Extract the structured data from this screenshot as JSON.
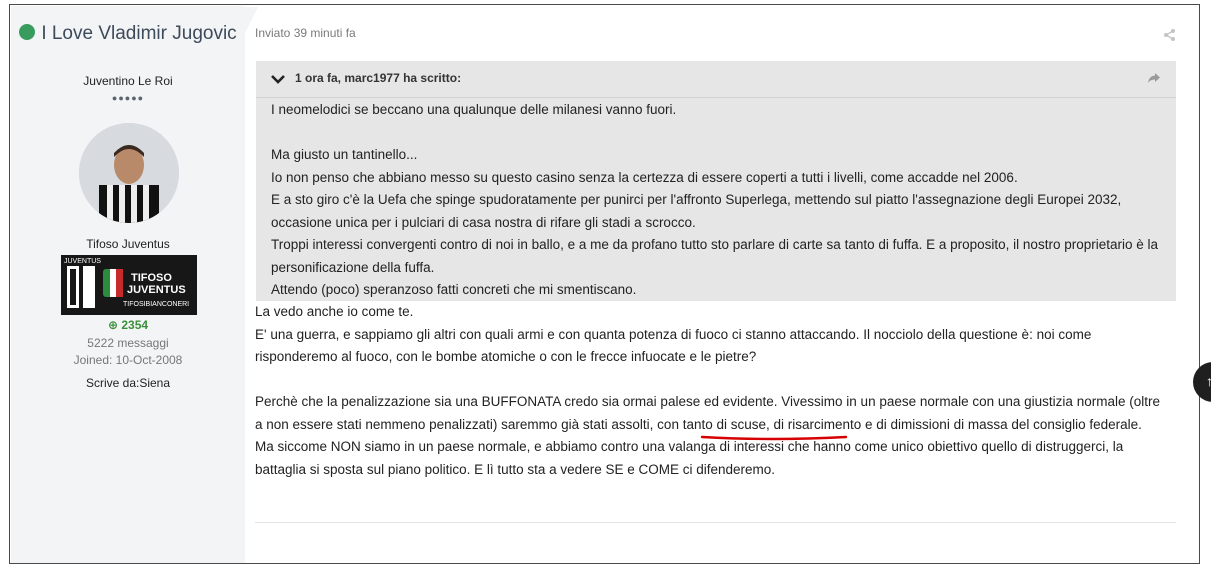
{
  "author": {
    "name": "I Love Vladimir Jugovic",
    "title": "Juventino Le Roi",
    "rank": "Tifoso Juventus",
    "reputation": "2354",
    "posts": "5222 messaggi",
    "joined": "Joined: 10-Oct-2008",
    "location": "Scrive da:Siena",
    "online_color": "#3a9b5f",
    "badge": {
      "top_label": "JUVENTUS",
      "line1": "TIFOSO",
      "line2": "JUVENTUS",
      "site": "TIFOSIBIANCONERI"
    }
  },
  "post": {
    "meta": "Inviato 39 minuti fa",
    "quote": {
      "citation": "1 ora fa, marc1977 ha scritto:",
      "lines": [
        "I neomelodici se beccano una qualunque delle milanesi vanno fuori.",
        "",
        "Ma giusto un tantinello...",
        "Io non penso che abbiano messo su questo casino senza la certezza di essere coperti a tutti i livelli, come accadde nel 2006.",
        "E a sto giro c'è la Uefa che spinge spudoratamente per punirci per l'affronto Superlega, mettendo sul piatto l'assegnazione degli Europei 2032, occasione unica per i pulciari di casa nostra di rifare gli stadi a scrocco.",
        "Troppi interessi convergenti contro di noi in ballo, e a me da profano tutto sto parlare di carte sa tanto di fuffa. E a proposito, il nostro proprietario è la personificazione della fuffa.",
        "Attendo (poco) speranzoso fatti concreti che mi smentiscano."
      ]
    },
    "body": {
      "p1": "La vedo anche io come te.",
      "p2": "E' una guerra, e sappiamo gli altri con quali armi e con quanta potenza di fuoco ci stanno attaccando. Il nocciolo della questione è: noi come risponderemo al fuoco, con le bombe atomiche o con le frecce infuocate e le pietre?",
      "p3": "Perchè che la penalizzazione sia una BUFFONATA credo sia ormai palese ed evidente. Vivessimo in un paese normale con una giustizia normale (oltre a non essere stati nemmeno penalizzati) saremmo già stati assolti, con tanto di scuse, di risarcimento e di dimissioni di massa del consiglio federale.",
      "p4": "Ma siccome NON siamo in un paese normale, e abbiamo contro una valanga di interessi che hanno come unico obiettivo quello di distruggerci, la battaglia si sposta sul piano politico. E lì tutto sta a vedere SE e COME ci difenderemo."
    }
  },
  "icons": {
    "share": "share-icon",
    "chevron": "chevron-down-icon",
    "quote_share": "share-arrow-icon"
  },
  "colors": {
    "quote_bg": "#e6e6e6",
    "sidebar_bg": "#f3f4f6",
    "annotation_red": "#d60000"
  }
}
